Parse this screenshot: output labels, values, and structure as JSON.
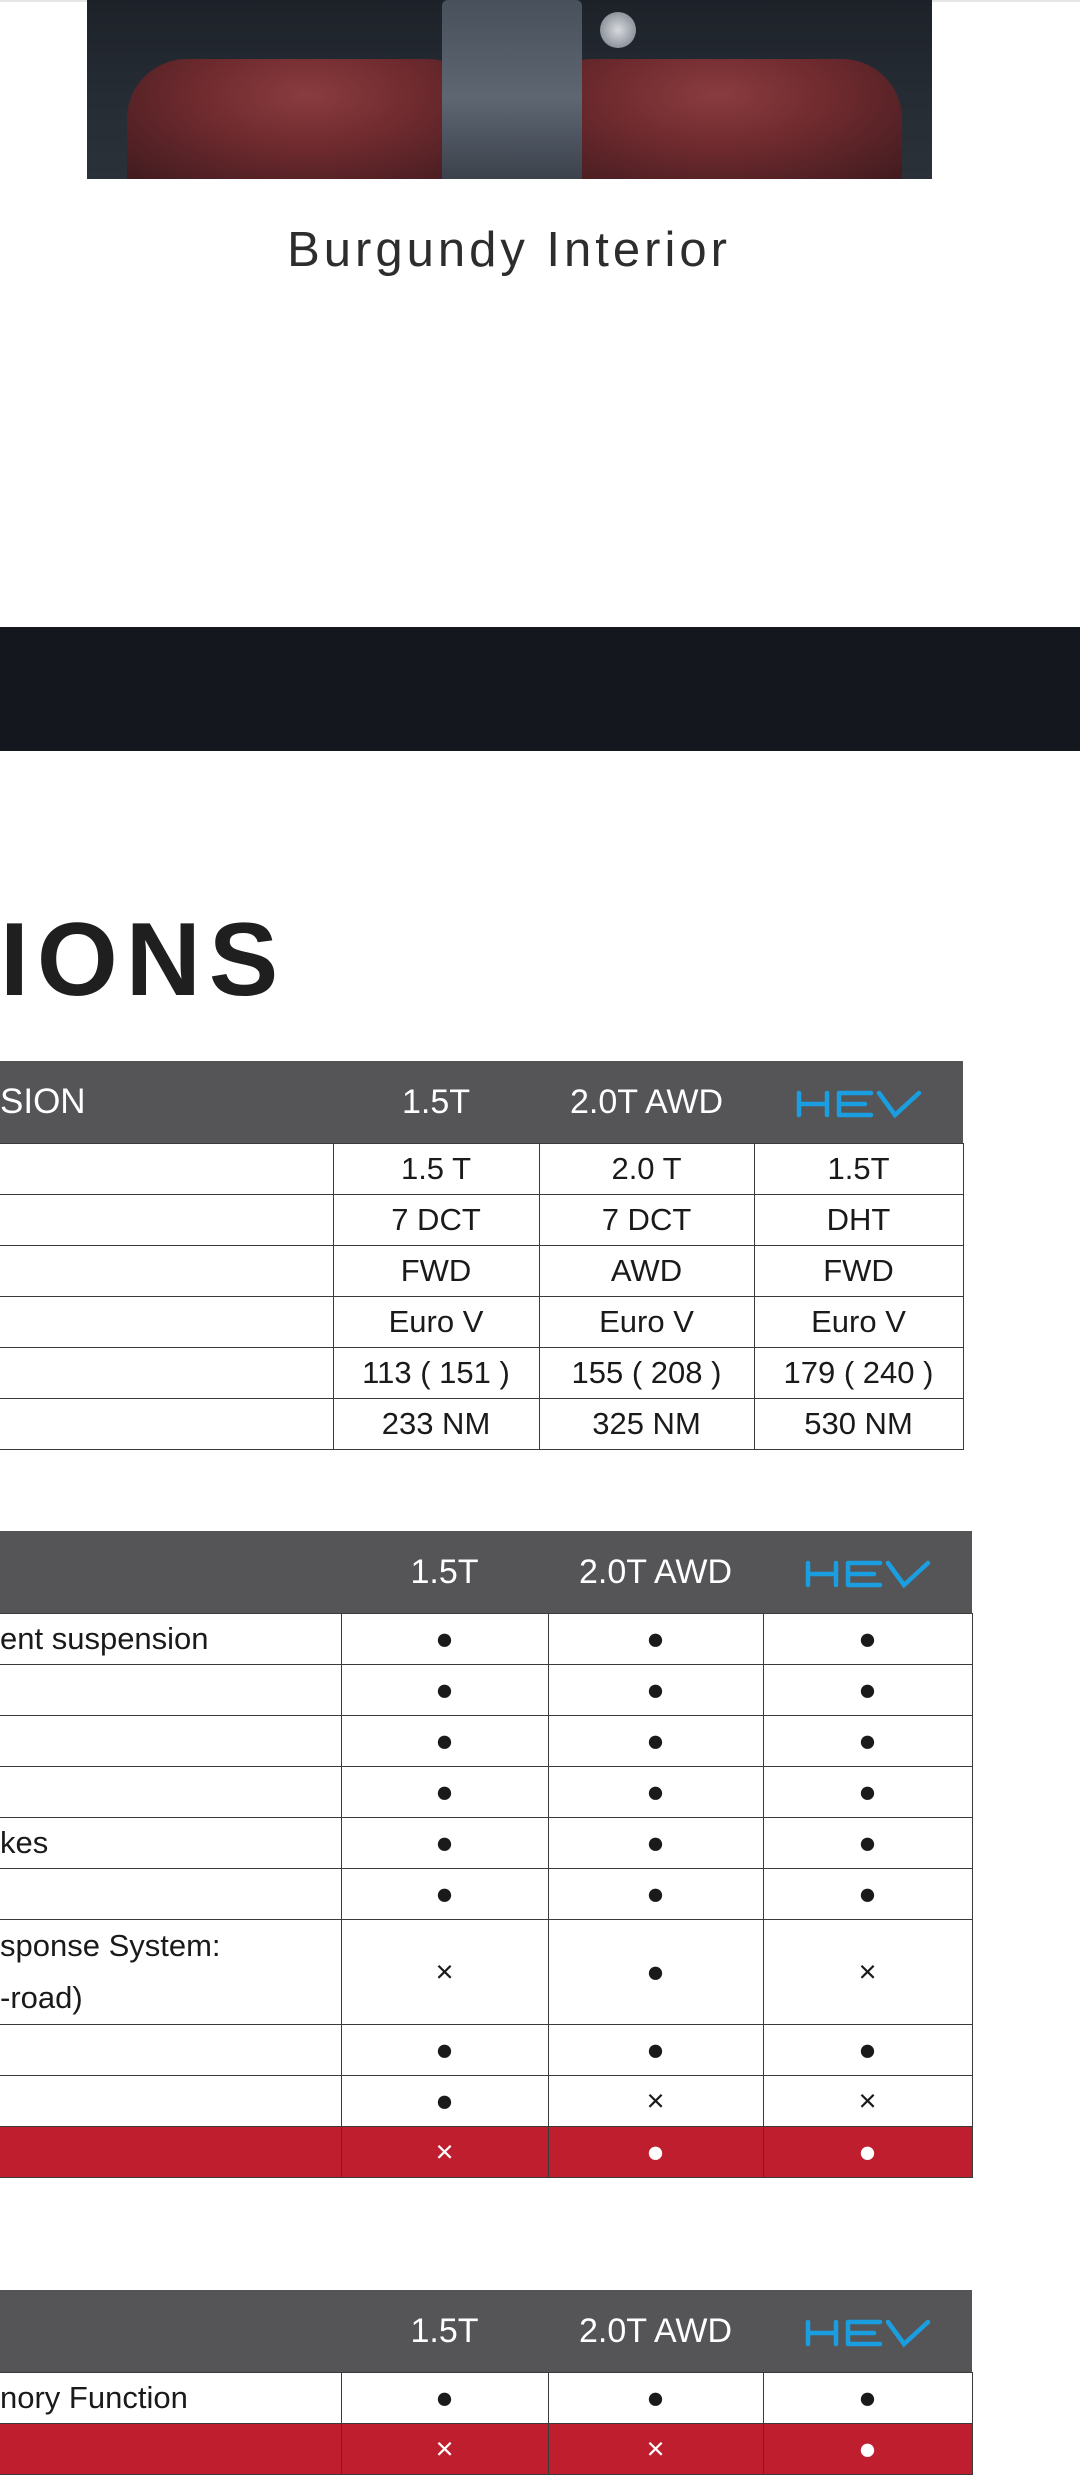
{
  "gallery": {
    "caption": "Burgundy Interior"
  },
  "section": {
    "title": "IONS"
  },
  "colors": {
    "header_bg": "#555558",
    "highlight_row": "#bf1e2e",
    "band": "#14171d",
    "hev_blue": "#1b9ee0"
  },
  "icons": {
    "included": "filled-dot",
    "excluded": "cross",
    "hev": "hev-logo"
  },
  "tables": [
    {
      "header": [
        "SION",
        "1.5T",
        "2.0T AWD",
        "HEV"
      ],
      "rows": [
        {
          "label": "",
          "cells": [
            "1.5 T",
            "2.0 T",
            "1.5T"
          ]
        },
        {
          "label": "",
          "cells": [
            "7 DCT",
            "7 DCT",
            "DHT"
          ]
        },
        {
          "label": "",
          "cells": [
            "FWD",
            "AWD",
            "FWD"
          ]
        },
        {
          "label": "",
          "cells": [
            "Euro V",
            "Euro V",
            "Euro V"
          ]
        },
        {
          "label": "",
          "cells": [
            "113 ( 151 )",
            "155 ( 208 )",
            "179 ( 240 )"
          ]
        },
        {
          "label": "",
          "cells": [
            "233 NM",
            "325 NM",
            "530 NM"
          ]
        }
      ]
    },
    {
      "header": [
        "",
        "1.5T",
        "2.0T AWD",
        "HEV"
      ],
      "rows": [
        {
          "label": "ent suspension",
          "cells": [
            "●",
            "●",
            "●"
          ]
        },
        {
          "label": "",
          "cells": [
            "●",
            "●",
            "●"
          ]
        },
        {
          "label": "",
          "cells": [
            "●",
            "●",
            "●"
          ]
        },
        {
          "label": "",
          "cells": [
            "●",
            "●",
            "●"
          ]
        },
        {
          "label": "kes",
          "cells": [
            "●",
            "●",
            "●"
          ]
        },
        {
          "label": "",
          "cells": [
            "●",
            "●",
            "●"
          ]
        },
        {
          "label": "sponse System:",
          "label2": "-road)",
          "cells": [
            "×",
            "●",
            "×"
          ]
        },
        {
          "label": "",
          "cells": [
            "●",
            "●",
            "●"
          ]
        },
        {
          "label": "",
          "cells": [
            "●",
            "×",
            "×"
          ]
        },
        {
          "label": "",
          "cells": [
            "×",
            "●",
            "●"
          ],
          "highlight": true
        }
      ]
    },
    {
      "header": [
        "",
        "1.5T",
        "2.0T AWD",
        "HEV"
      ],
      "rows": [
        {
          "label": "nory Function",
          "cells": [
            "●",
            "●",
            "●"
          ]
        },
        {
          "label": "",
          "cells": [
            "×",
            "×",
            "●"
          ],
          "highlight": true
        }
      ]
    }
  ]
}
